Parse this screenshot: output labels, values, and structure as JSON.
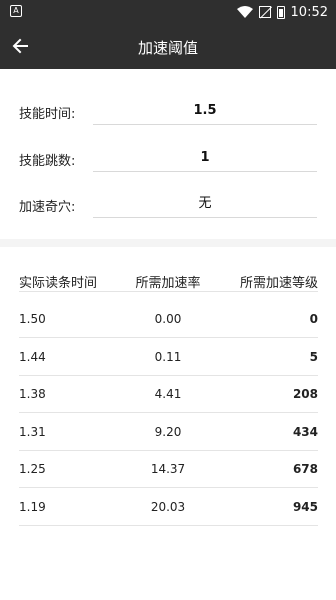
{
  "status_bar": {
    "time": "10:52",
    "icons": [
      "app-notification-icon",
      "wifi-icon",
      "no-sim-icon",
      "battery-icon"
    ]
  },
  "app_bar": {
    "title": "加速阈值",
    "back_icon": "arrow-left-icon"
  },
  "form": {
    "rows": [
      {
        "label": "技能时间:",
        "value": "1.5"
      },
      {
        "label": "技能跳数:",
        "value": "1"
      },
      {
        "label": "加速奇穴:",
        "value": "无"
      }
    ]
  },
  "table": {
    "headers": [
      "实际读条时间",
      "所需加速率",
      "所需加速等级"
    ],
    "rows": [
      [
        "1.50",
        "0.00",
        "0"
      ],
      [
        "1.44",
        "0.11",
        "5"
      ],
      [
        "1.38",
        "4.41",
        "208"
      ],
      [
        "1.31",
        "9.20",
        "434"
      ],
      [
        "1.25",
        "14.37",
        "678"
      ],
      [
        "1.19",
        "20.03",
        "945"
      ]
    ]
  },
  "colors": {
    "app_bar": "#2f2f2f",
    "divider": "#f4f4f4"
  }
}
